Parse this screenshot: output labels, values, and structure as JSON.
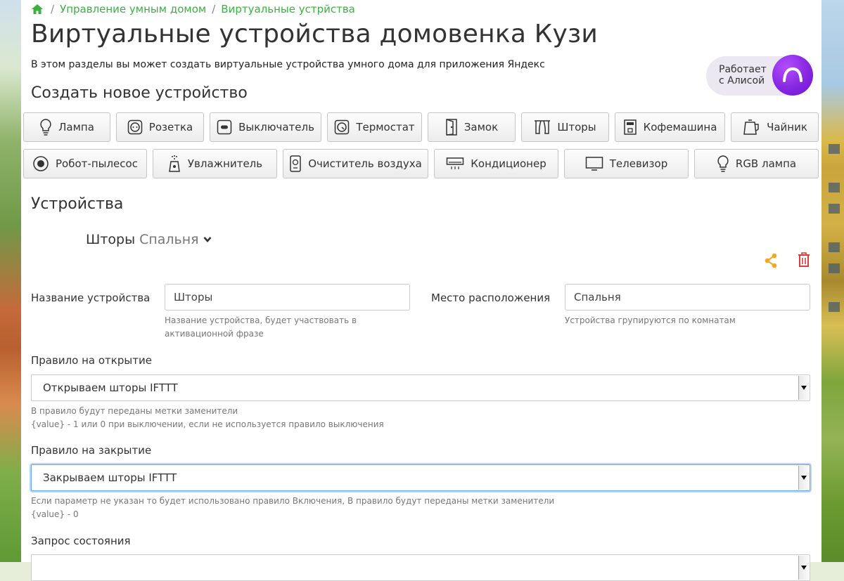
{
  "breadcrumb": {
    "home_icon": "home-icon",
    "items": [
      "Управление умным домом",
      "Виртуальные устрйства"
    ],
    "separator": "/"
  },
  "page": {
    "title": "Виртуальные устройства домовенка Кузи",
    "intro": "В этом разделы вы может создать виртуальные устройства умного дома для приложения Яндекс"
  },
  "alice_badge": {
    "line1": "Работает",
    "line2": "с Алисой"
  },
  "create": {
    "heading": "Создать новое устройство",
    "buttons": [
      {
        "label": "Лампа",
        "icon": "lamp-icon"
      },
      {
        "label": "Розетка",
        "icon": "socket-icon"
      },
      {
        "label": "Выключатель",
        "icon": "switch-icon"
      },
      {
        "label": "Термостат",
        "icon": "thermostat-icon"
      },
      {
        "label": "Замок",
        "icon": "lock-door-icon"
      },
      {
        "label": "Шторы",
        "icon": "curtains-icon"
      },
      {
        "label": "Кофемашина",
        "icon": "coffee-machine-icon"
      },
      {
        "label": "Чайник",
        "icon": "kettle-icon"
      },
      {
        "label": "Робот-пылесос",
        "icon": "robot-vacuum-icon"
      },
      {
        "label": "Увлажнитель",
        "icon": "humidifier-icon"
      },
      {
        "label": "Очиститель воздуха",
        "icon": "air-purifier-icon"
      },
      {
        "label": "Кондиционер",
        "icon": "air-conditioner-icon"
      },
      {
        "label": "Телевизор",
        "icon": "tv-icon"
      },
      {
        "label": "RGB лампа",
        "icon": "rgb-lamp-icon"
      }
    ]
  },
  "devices": {
    "heading": "Устройства",
    "current": {
      "name": "Шторы",
      "room": "Спальня"
    },
    "actions": {
      "share_icon": "share-icon",
      "delete_icon": "trash-icon",
      "share_color": "#f5a623",
      "delete_color": "#e03b3b"
    }
  },
  "form": {
    "name_label": "Название устройства",
    "name_value": "Шторы",
    "name_help": "Название устройства, будет участвовать в активационной фразе",
    "place_label": "Место расположения",
    "place_value": "Спальня",
    "place_help": "Устройства групируются по комнатам",
    "open_label": "Правило на открытие",
    "open_value": "Открываем шторы IFTTT",
    "open_help1": "В правило будут переданы метки заменители",
    "open_help2": "{value} - 1 или 0 при выключении, если не используется правило выключения",
    "close_label": "Правило на закрытие",
    "close_value": "Закрываем шторы IFTTT",
    "close_help1": "Если параметр не указан то будет использовано правило Включения, В правило будут переданы метки заменители",
    "close_help2": "{value} - 0",
    "state_label": "Запрос состояния"
  },
  "colors": {
    "link": "#3cb043",
    "focus": "#6aa9e9"
  }
}
